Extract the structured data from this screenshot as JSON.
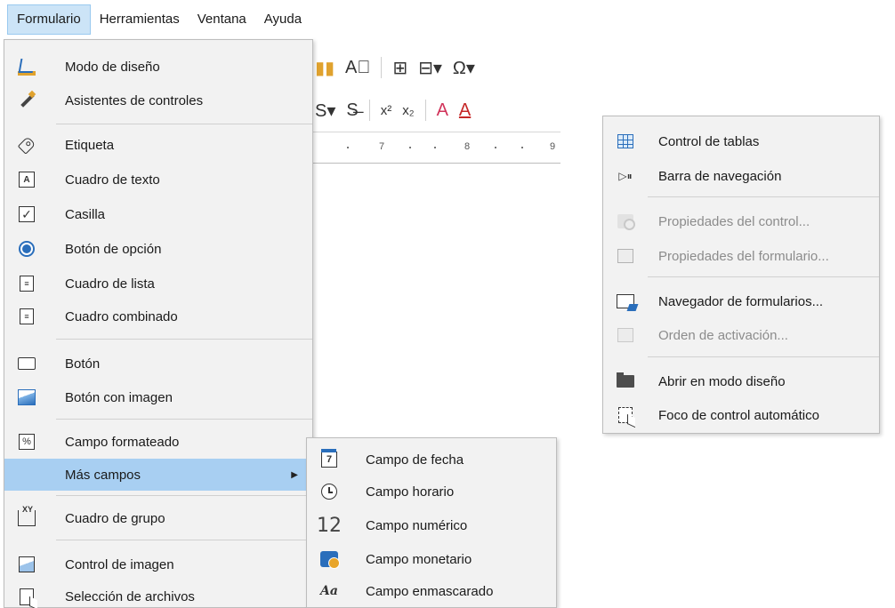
{
  "menubar": {
    "items": [
      {
        "label": "Formulario",
        "active": true
      },
      {
        "label": "Herramientas"
      },
      {
        "label": "Ventana"
      },
      {
        "label": "Ayuda"
      }
    ]
  },
  "toolbar": {
    "row1_glyphs": [
      "▮▮",
      "A⃞",
      "⊞",
      "⊟▾",
      "Ω▾"
    ],
    "row2_glyphs": [
      "S▾",
      "S̶",
      "x²",
      "x₂",
      "A",
      "A"
    ]
  },
  "ruler": {
    "labels": [
      "7",
      "8",
      "9"
    ]
  },
  "formulario_menu": {
    "items": [
      {
        "label": "Modo de diseño",
        "icon": "design-mode-icon"
      },
      {
        "label": "Asistentes de controles",
        "icon": "wizard-icon"
      },
      {
        "label": "Etiqueta",
        "icon": "label-icon"
      },
      {
        "label": "Cuadro de texto",
        "icon": "text-box-icon"
      },
      {
        "label": "Casilla",
        "icon": "checkbox-icon"
      },
      {
        "label": "Botón de opción",
        "icon": "radio-button-icon"
      },
      {
        "label": "Cuadro de lista",
        "icon": "list-box-icon"
      },
      {
        "label": "Cuadro combinado",
        "icon": "combo-box-icon"
      },
      {
        "label": "Botón",
        "icon": "push-button-icon"
      },
      {
        "label": "Botón con imagen",
        "icon": "image-button-icon"
      },
      {
        "label": "Campo formateado",
        "icon": "formatted-field-icon"
      },
      {
        "label": "Más campos",
        "icon": "",
        "submenu": true,
        "highlighted": true
      },
      {
        "label": "Cuadro de grupo",
        "icon": "group-box-icon"
      },
      {
        "label": "Control de imagen",
        "icon": "image-control-icon"
      },
      {
        "label": "Selección de archivos",
        "icon": "file-selection-icon"
      }
    ],
    "text_box_icon_text": "A",
    "formatted_icon_text": "%",
    "group_icon_text": "XY",
    "check_glyph": "✓",
    "list_glyph": "≡",
    "combo_glyph": "≡",
    "submenu_arrow": "▶"
  },
  "mas_campos_submenu": {
    "items": [
      {
        "label": "Campo de fecha",
        "icon": "date-field-icon"
      },
      {
        "label": "Campo horario",
        "icon": "time-field-icon"
      },
      {
        "label": "Campo numérico",
        "icon": "numeric-field-icon"
      },
      {
        "label": "Campo monetario",
        "icon": "currency-field-icon"
      },
      {
        "label": "Campo enmascarado",
        "icon": "pattern-field-icon"
      }
    ],
    "date_icon_text": "7",
    "numeric_icon_text": "12",
    "pattern_icon_text": "Aa"
  },
  "context_menu": {
    "items": [
      {
        "label": "Control de tablas",
        "icon": "table-control-icon",
        "enabled": true
      },
      {
        "label": "Barra de navegación",
        "icon": "navigation-bar-icon",
        "enabled": true
      },
      {
        "label": "Propiedades del control...",
        "icon": "control-properties-icon",
        "enabled": false
      },
      {
        "label": "Propiedades del formulario...",
        "icon": "form-properties-icon",
        "enabled": false
      },
      {
        "label": "Navegador de formularios...",
        "icon": "form-navigator-icon",
        "enabled": true
      },
      {
        "label": "Orden de activación...",
        "icon": "activation-order-icon",
        "enabled": false
      },
      {
        "label": "Abrir en modo diseño",
        "icon": "folder-open-icon",
        "enabled": true
      },
      {
        "label": "Foco de control automático",
        "icon": "auto-focus-icon",
        "enabled": true
      }
    ],
    "nav_glyph": "▷⏸"
  },
  "colors": {
    "menu_bg": "#f2f2f2",
    "highlight": "#a8cff2",
    "menubar_active": "#cce4f7",
    "accent": "#2a6ebb",
    "disabled_text": "#8c8c8c"
  }
}
